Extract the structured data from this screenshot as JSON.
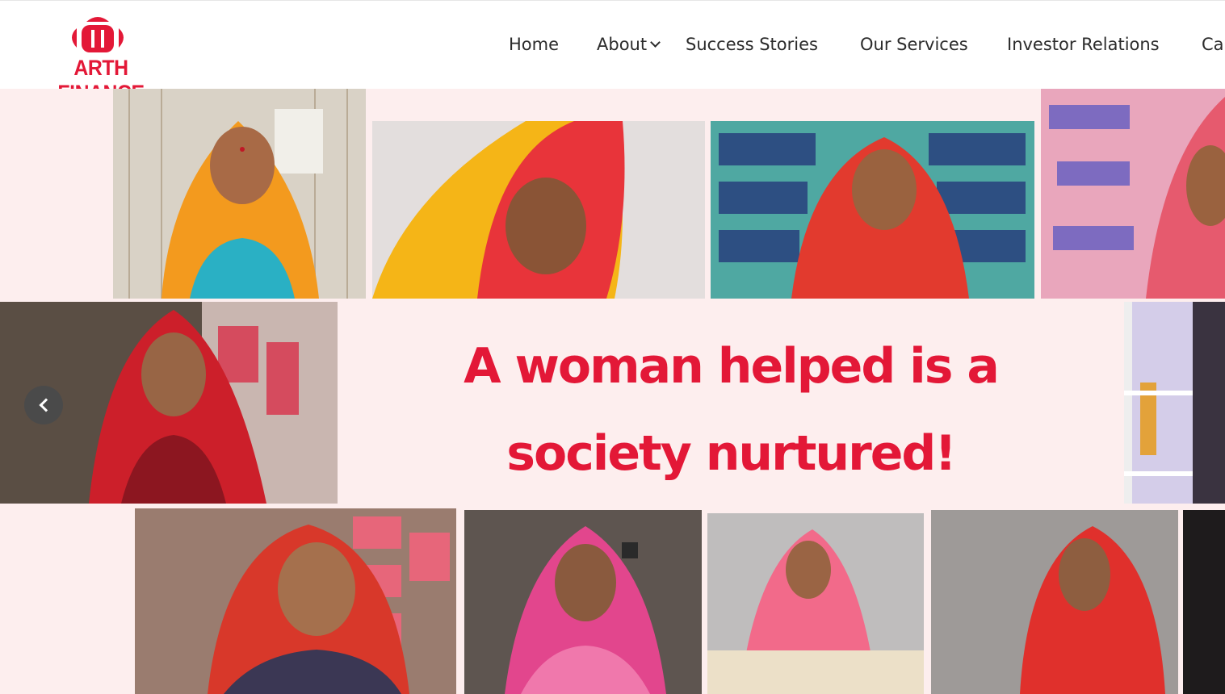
{
  "brand": {
    "name": "ARTH FINANCE",
    "logo_icon": "arth-logo-mark",
    "color": "#e31837"
  },
  "nav": {
    "items": [
      {
        "label": "Home"
      },
      {
        "label": "About",
        "icon": "chevron-down-icon"
      },
      {
        "label": "Success Stories"
      },
      {
        "label": "Our Services"
      },
      {
        "label": "Investor Relations"
      },
      {
        "label": "Ca"
      }
    ]
  },
  "hero": {
    "headline_line1": "A woman helped is a",
    "headline_line2": "society nurtured!",
    "background_color": "#fdeeee",
    "accent_color": "#e31837",
    "prev_icon": "chevron-left-icon",
    "photos": [
      "woman-orange-dupatta-at-loom",
      "woman-yellow-red-dupatta-sewing",
      "woman-red-saree-in-shop",
      "woman-pink-dupatta-in-shop",
      "woman-red-dupatta-threading",
      "shop-shelf-bangles",
      "woman-red-saree-in-store",
      "woman-pink-dupatta-smiling",
      "woman-pink-dupatta-embroidering",
      "woman-red-dupatta-profile",
      "dark-photo-edge"
    ]
  }
}
